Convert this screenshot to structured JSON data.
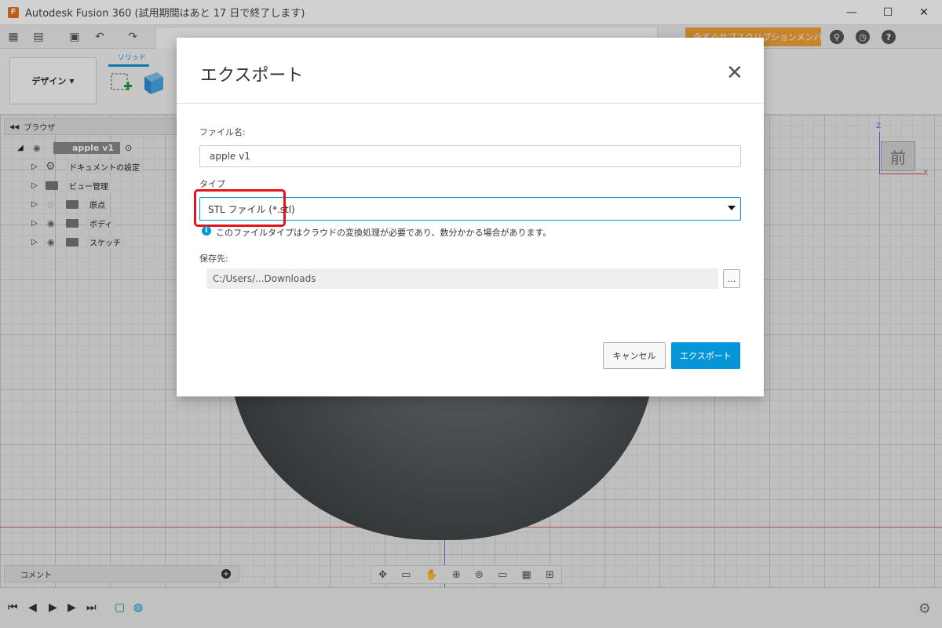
{
  "window": {
    "title": "Autodesk Fusion 360 (試用期間はあと 17 日で終了します)",
    "logo_letter": "F"
  },
  "toolbar": {
    "subscribe_label": "今すぐサブスクリプションメンバーに..."
  },
  "ribbon": {
    "workspace_label": "デザイン",
    "solid_tab_label": "ソリッド"
  },
  "browser": {
    "header_label": "ブラウザ",
    "root_label": "apple v1",
    "items": [
      {
        "label": "ドキュメントの設定",
        "icon": "gear-icon"
      },
      {
        "label": "ビュー管理",
        "icon": "folder-icon"
      },
      {
        "label": "原点",
        "icon": "folder-icon"
      },
      {
        "label": "ボディ",
        "icon": "folder-icon"
      },
      {
        "label": "スケッチ",
        "icon": "folder-icon"
      }
    ]
  },
  "viewcube": {
    "face_label": "前",
    "z_label": "Z",
    "x_label": "X"
  },
  "comments": {
    "label": "コメント"
  },
  "dialog": {
    "title": "エクスポート",
    "filename_label": "ファイル名:",
    "filename_value": "apple v1",
    "type_label": "タイプ",
    "type_value": "STL ファイル (*.stl)",
    "info_text": "このファイルタイプはクラウドの変換処理が必要であり、数分かかる場合があります。",
    "save_to_label": "保存先:",
    "save_to_value": "C:/Users/...Downloads",
    "browse_label": "...",
    "cancel_label": "キャンセル",
    "export_label": "エクスポート"
  },
  "colors": {
    "accent": "#0696d7",
    "highlight": "#e3141a",
    "subscribe": "#f2a33a"
  }
}
